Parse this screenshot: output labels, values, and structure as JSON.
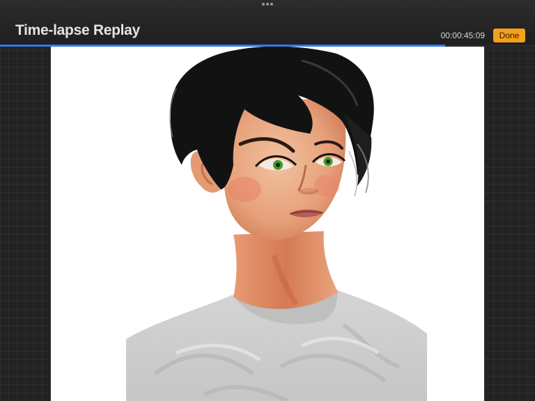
{
  "app": {
    "title": "Time-lapse Replay",
    "timer": "00:00:45:09",
    "done_label": "Done"
  },
  "playback": {
    "progress_fraction": 0.832
  },
  "colors": {
    "accent_progress": "#2e7ce6",
    "done_button": "#f4a11b",
    "chrome_background": "#232323"
  },
  "icons": {
    "grabber": "more-dots-icon"
  }
}
